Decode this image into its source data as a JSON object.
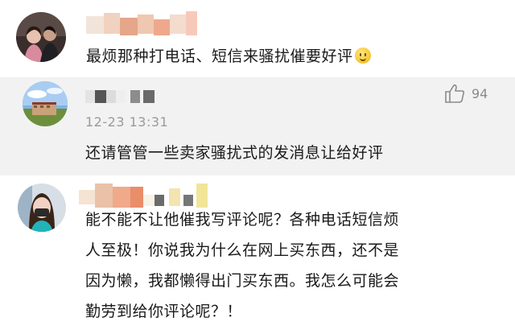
{
  "comments": [
    {
      "text": "最烦那种打电话、短信来骚扰催要好评",
      "emoji": "slightly-smiling-face-icon"
    },
    {
      "like_count": "94",
      "like_icon": "thumbs-up-icon",
      "timestamp": "12-23 13:31",
      "text": "还请管管一些卖家骚扰式的发消息让给好评"
    },
    {
      "lines": [
        "能不能不让他催我写评论呢？各种电话短信烦",
        "人至极！你说我为什么在网上买东西，还不是",
        "因为懒，我都懒得出门买东西。我怎么可能会",
        "勤劳到给你评论呢？！"
      ]
    }
  ]
}
